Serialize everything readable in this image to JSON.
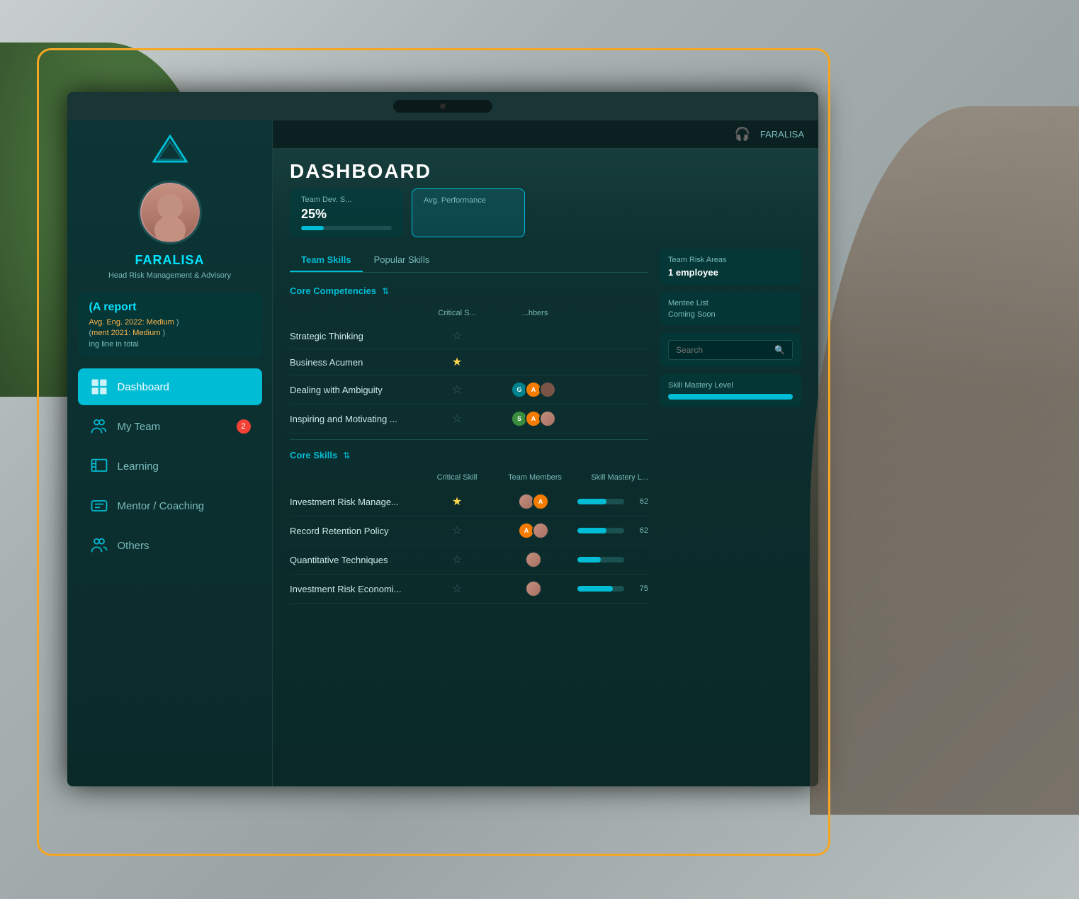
{
  "background": {
    "color": "#b0b8b8"
  },
  "monitor": {
    "header": {
      "username": "FARALISA",
      "headphone_icon": "🎧"
    },
    "sidebar": {
      "logo_alt": "App Logo",
      "user": {
        "name": "FARALISA",
        "title": "Head Risk Management & Advisory"
      },
      "report": {
        "title": "report",
        "prefix_a": "(A",
        "eng_label": "Avg. Eng.",
        "year1": "2022:",
        "level1": "Medium",
        "year2_label": "ment 2021:",
        "level2": "Medium",
        "total_label": "ing line in total"
      },
      "nav_items": [
        {
          "id": "dashboard",
          "label": "Dashboard",
          "active": true,
          "badge": null
        },
        {
          "id": "my-team",
          "label": "My Team",
          "active": false,
          "badge": 2
        },
        {
          "id": "learning",
          "label": "Learning",
          "active": false,
          "badge": null
        },
        {
          "id": "mentor-coaching",
          "label": "Mentor / Coaching",
          "active": false,
          "badge": null
        },
        {
          "id": "others",
          "label": "Others",
          "active": false,
          "badge": null
        }
      ]
    },
    "main": {
      "title": "DASHBOARD",
      "stat_cards": [
        {
          "id": "team-dev",
          "label": "Team Dev. S...",
          "value": "25%",
          "progress": 25,
          "highlight": false
        },
        {
          "id": "avg-performance",
          "label": "Avg. Performance",
          "value": "",
          "highlight": true
        }
      ],
      "tabs": [
        {
          "id": "team-skills",
          "label": "Team Skills",
          "active": true
        },
        {
          "id": "popular-skills",
          "label": "Popular Skills",
          "active": false
        }
      ],
      "core_competencies": {
        "title": "Core Competencies",
        "col_critical": "Critical S...",
        "col_members": "...hbers",
        "skills": [
          {
            "name": "Strategic Thinking",
            "critical": true,
            "avatars": [],
            "mastery": null,
            "mastery_num": null
          },
          {
            "name": "Business Acumen",
            "critical": false,
            "avatars": [],
            "mastery": null,
            "mastery_num": null
          },
          {
            "name": "Dealing with Ambiguity",
            "critical": false,
            "avatars": [
              {
                "color": "teal",
                "initial": "G"
              },
              {
                "color": "amber",
                "initial": "A"
              },
              {
                "color": "brown",
                "initial": ""
              }
            ],
            "mastery": null,
            "mastery_num": null
          },
          {
            "name": "Inspiring and Motivating ...",
            "critical": false,
            "avatars": [
              {
                "color": "green",
                "initial": "S"
              },
              {
                "color": "amber",
                "initial": "A"
              },
              {
                "color": "photo",
                "initial": ""
              }
            ],
            "mastery": null,
            "mastery_num": null
          }
        ]
      },
      "core_skills": {
        "title": "Core Skills",
        "col_critical": "Critical Skill",
        "col_members": "Team Members",
        "col_mastery": "Skill Mastery L...",
        "skills": [
          {
            "name": "Investment Risk Manage...",
            "critical": true,
            "avatars": [
              {
                "color": "photo",
                "initial": ""
              },
              {
                "color": "amber",
                "initial": "A"
              }
            ],
            "mastery": 62,
            "mastery_num": "62"
          },
          {
            "name": "Record Retention Policy",
            "critical": false,
            "avatars": [
              {
                "color": "amber",
                "initial": "A"
              },
              {
                "color": "photo",
                "initial": ""
              }
            ],
            "mastery": 62,
            "mastery_num": "62"
          },
          {
            "name": "Quantitative Techniques",
            "critical": false,
            "avatars": [
              {
                "color": "photo",
                "initial": ""
              }
            ],
            "mastery": 50,
            "mastery_num": ""
          },
          {
            "name": "Investment Risk Economi...",
            "critical": false,
            "avatars": [
              {
                "color": "photo",
                "initial": ""
              }
            ],
            "mastery": 75,
            "mastery_num": "75"
          }
        ]
      },
      "right_panel": {
        "team_risk": {
          "title": "Team Risk Areas",
          "value": "1 employee"
        },
        "mentee_list": {
          "title": "Mentee List",
          "value": "Coming Soon"
        },
        "search_placeholder": "Search",
        "skill_mastery_label": "Skill Mastery Level"
      }
    }
  }
}
